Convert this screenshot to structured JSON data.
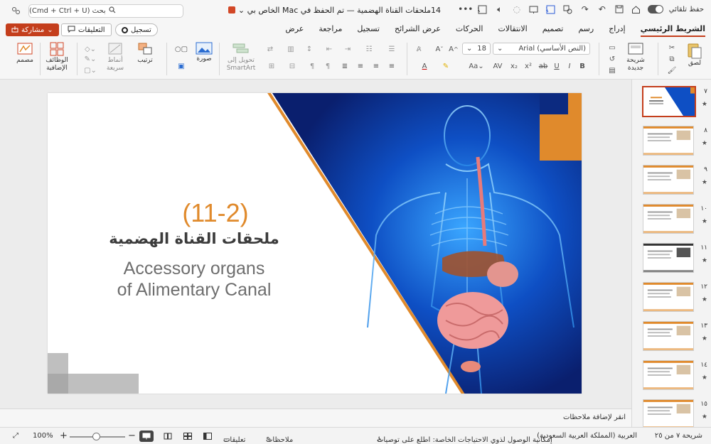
{
  "titlebar": {
    "autosave_label": "حفظ تلقائي",
    "doc_title": "14ملحقات القناة الهضمية — تم الحفظ في Mac الخاص بي ⌄",
    "search_placeholder": "بحث (Cmd + Ctrl + U)"
  },
  "tabs": [
    {
      "label": "الشريط الرئيسي",
      "active": true
    },
    {
      "label": "إدراج"
    },
    {
      "label": "رسم"
    },
    {
      "label": "تصميم"
    },
    {
      "label": "الانتقالات"
    },
    {
      "label": "الحركات"
    },
    {
      "label": "عرض الشرائح"
    },
    {
      "label": "تسجيل"
    },
    {
      "label": "مراجعة"
    },
    {
      "label": "عرض"
    }
  ],
  "actions": {
    "share": "مشاركة",
    "comments": "التعليقات",
    "record": "تسجيل"
  },
  "ribbon": {
    "paste": "لصق",
    "new_slide_line1": "شريحة",
    "new_slide_line2": "جديدة",
    "font_name": "Arial (النص الأساسي)",
    "font_size": "18",
    "picture": "صورة",
    "arrange": "ترتيب",
    "quick_styles_line1": "أنماط",
    "quick_styles_line2": "سريعة",
    "convert_smartart_line1": "تحويل إلى",
    "convert_smartart_line2": "SmartArt",
    "addins_line1": "الوظائف",
    "addins_line2": "الإضافية",
    "designer": "مصمم"
  },
  "slide": {
    "number_text": "(11-2)",
    "arabic_title": "ملحقات القناة الهضمية",
    "english_title_line1": "Accessory organs",
    "english_title_line2": "of Alimentary Canal"
  },
  "notes": {
    "placeholder": "انقر لإضافة ملاحظات"
  },
  "thumbnails": [
    {
      "number": "٧",
      "active": true
    },
    {
      "number": "٨"
    },
    {
      "number": "٩"
    },
    {
      "number": "١٠"
    },
    {
      "number": "١١"
    },
    {
      "number": "١٢"
    },
    {
      "number": "١٣"
    },
    {
      "number": "١٤"
    },
    {
      "number": "١٥"
    }
  ],
  "status": {
    "slide_counter": "شريحة ٧ من ٢٥",
    "language": "العربية (المملكة العربية السعودية)",
    "accessibility": "إمكانية الوصول لذوي الاحتياجات الخاصة: اطلع على توصيات",
    "notes": "ملاحظات",
    "comments": "تعليقات",
    "zoom": "100%"
  },
  "colors": {
    "accent": "#c43e1c",
    "slide_orange": "#e08a2c",
    "slide_blue": "#0a2a8a"
  }
}
